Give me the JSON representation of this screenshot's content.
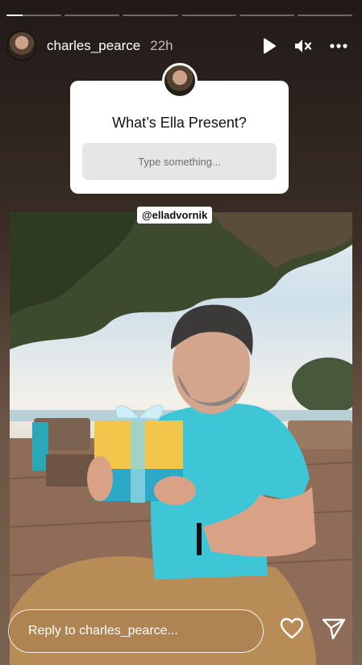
{
  "progress": {
    "segments": 6,
    "active_index": 0,
    "active_fill": 0.3
  },
  "header": {
    "username": "charles_pearce",
    "time": "22h",
    "icons": [
      "play-icon",
      "mute-icon",
      "more-icon"
    ]
  },
  "sticker": {
    "question": "What’s Ella Present?",
    "placeholder": "Type something..."
  },
  "mention": {
    "handle": "@elladvornik"
  },
  "reply": {
    "placeholder": "Reply to charles_pearce...",
    "icons": [
      "heart-icon",
      "send-icon"
    ]
  },
  "colors": {
    "shirt": "#3ec5d6",
    "gift_box": "#f2c64a",
    "gift_wrap": "#2da9c8"
  }
}
